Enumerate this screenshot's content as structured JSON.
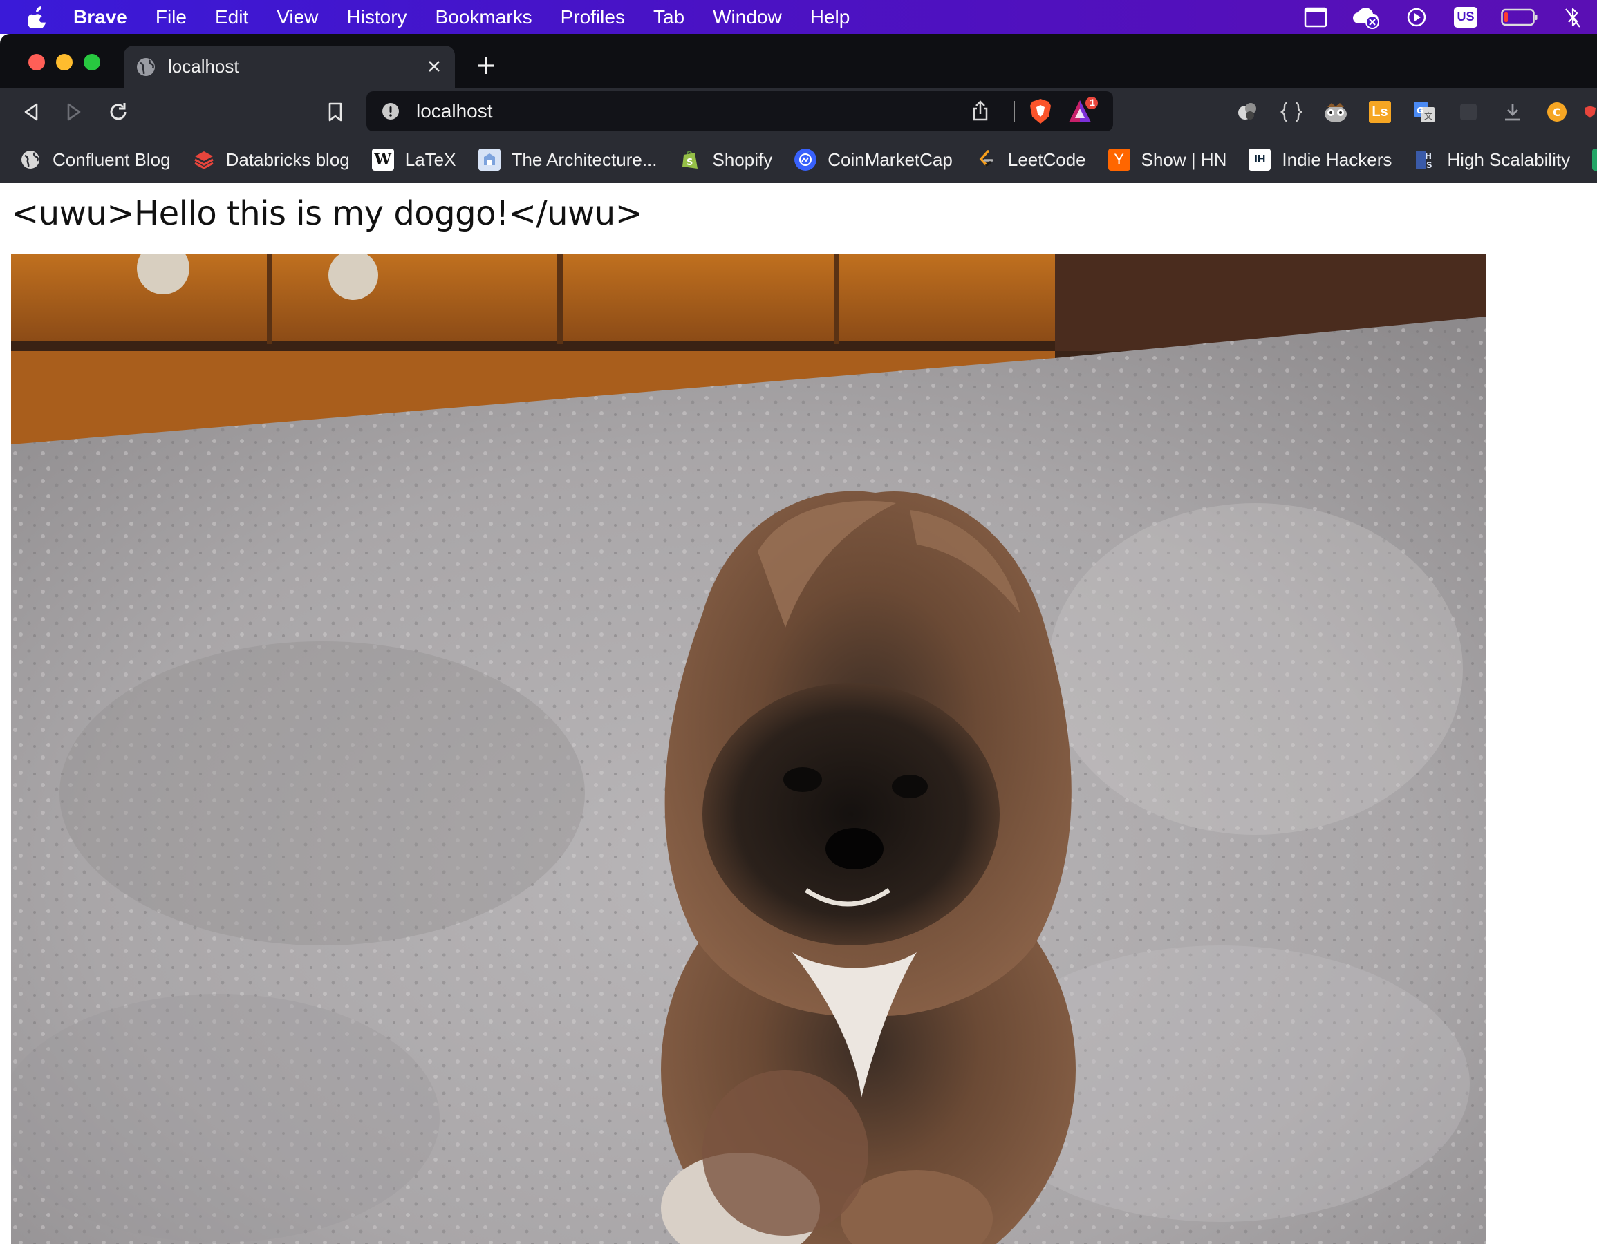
{
  "menubar": {
    "app_name": "Brave",
    "items": [
      "File",
      "Edit",
      "View",
      "History",
      "Bookmarks",
      "Profiles",
      "Tab",
      "Window",
      "Help"
    ],
    "tray": {
      "keyboard_layout": "US",
      "icons": [
        "window-icon",
        "cloud-sync-icon",
        "play-circle-icon",
        "keyboard-layout-icon",
        "battery-icon",
        "bluetooth-off-icon"
      ]
    }
  },
  "tab": {
    "title": "localhost"
  },
  "omnibox": {
    "url": "localhost",
    "rewards_badge": "1"
  },
  "extensions": [
    "ext-icon-1",
    "json-viewer-icon",
    "ext-icon-3",
    "ls-icon",
    "google-translate-icon",
    "ext-icon-6",
    "download-icon",
    "ext-icon-8"
  ],
  "bookmarks": [
    {
      "label": "Confluent Blog",
      "icon": "globe-icon",
      "color": "#e6e6e6"
    },
    {
      "label": "Databricks blog",
      "icon": "databricks-icon",
      "color": "#e8453c"
    },
    {
      "label": "LaTeX",
      "icon": "wikipedia-icon",
      "color": "#ffffff"
    },
    {
      "label": "The Architecture...",
      "icon": "architecture-icon",
      "color": "#a7c4ef"
    },
    {
      "label": "Shopify",
      "icon": "shopify-icon",
      "color": "#95bf47"
    },
    {
      "label": "CoinMarketCap",
      "icon": "coinmarketcap-icon",
      "color": "#3861fb"
    },
    {
      "label": "LeetCode",
      "icon": "leetcode-icon",
      "color": "#f89f1b"
    },
    {
      "label": "Show | HN",
      "icon": "hackernews-icon",
      "color": "#ff6600"
    },
    {
      "label": "Indie Hackers",
      "icon": "indiehackers-icon",
      "color": "#ffffff"
    },
    {
      "label": "High Scalability",
      "icon": "highscalability-icon",
      "color": "#3a5aa8"
    }
  ],
  "page": {
    "heading": "<uwu>Hello this is my doggo!</uwu>",
    "image_subject": "dog-photo"
  }
}
